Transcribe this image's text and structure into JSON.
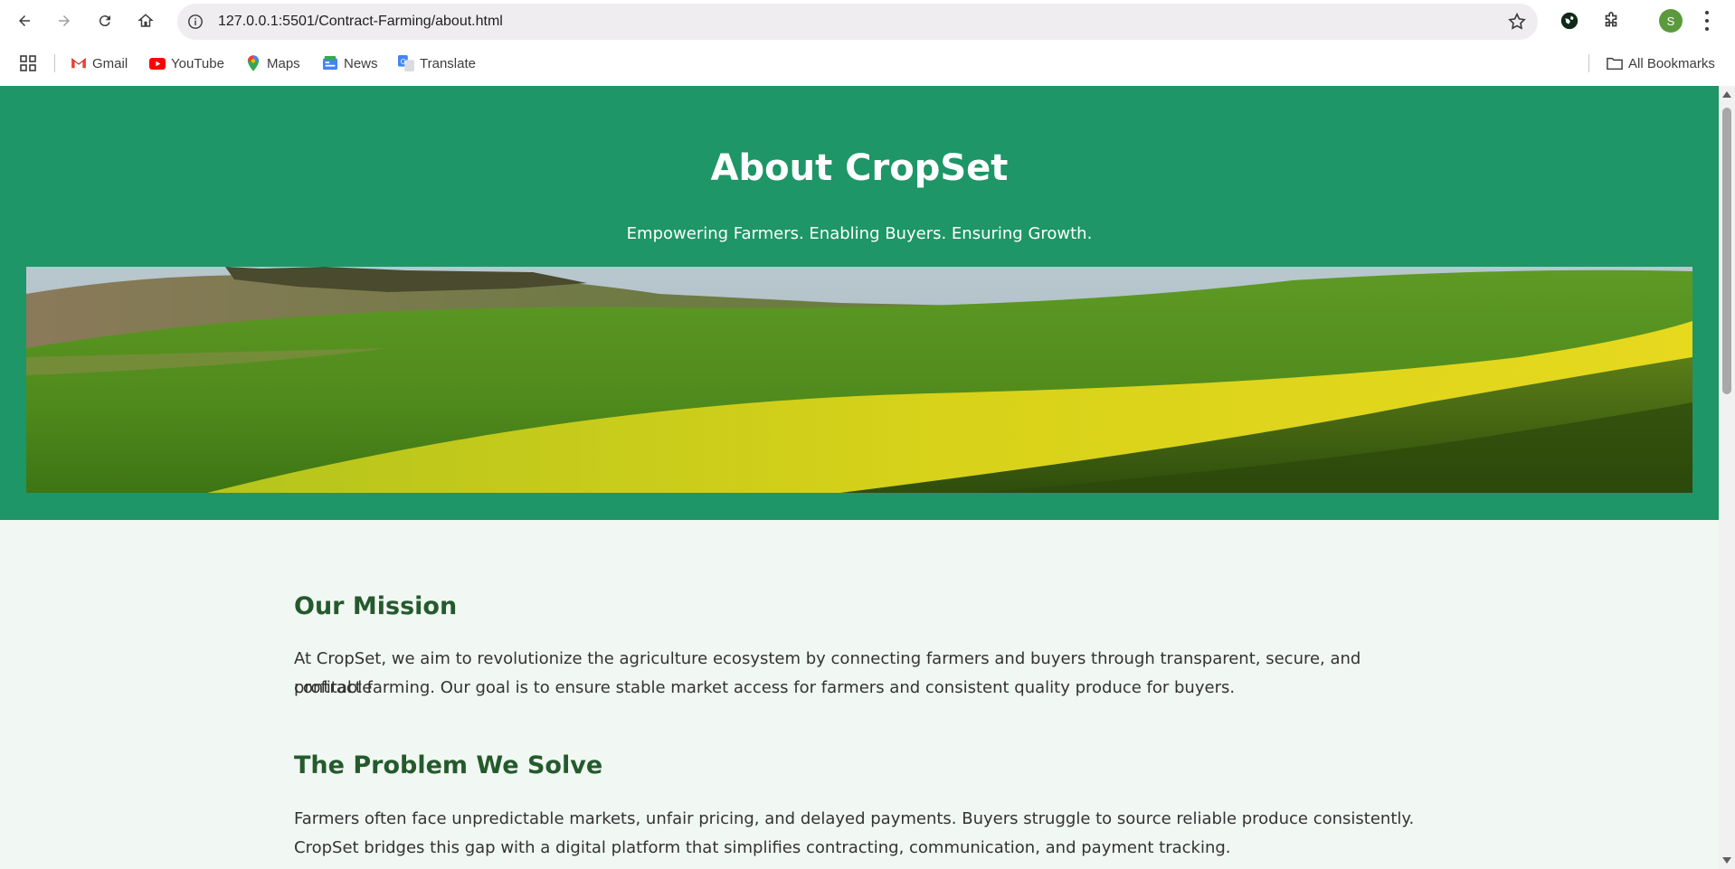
{
  "browser": {
    "url": "127.0.0.1:5501/Contract-Farming/about.html",
    "profile_initial": "S",
    "bookmarks": [
      {
        "label": "Gmail",
        "icon": "gmail-icon"
      },
      {
        "label": "YouTube",
        "icon": "youtube-icon"
      },
      {
        "label": "Maps",
        "icon": "maps-icon"
      },
      {
        "label": "News",
        "icon": "news-icon"
      },
      {
        "label": "Translate",
        "icon": "translate-icon"
      }
    ],
    "all_bookmarks_label": "All Bookmarks"
  },
  "page": {
    "title": "About CropSet",
    "tagline": "Empowering Farmers. Enabling Buyers. Ensuring Growth.",
    "banner_icon": "farmland-banner-image",
    "colors": {
      "hero": "#1e9667",
      "heading": "#245a2c",
      "background": "#f1f7f3"
    },
    "sections": [
      {
        "heading": "Our Mission",
        "lines": [
          "At CropSet, we aim to revolutionize the agriculture ecosystem by connecting farmers and buyers through transparent, secure, and profitable",
          "contract farming. Our goal is to ensure stable market access for farmers and consistent quality produce for buyers."
        ]
      },
      {
        "heading": "The Problem We Solve",
        "lines": [
          "Farmers often face unpredictable markets, unfair pricing, and delayed payments. Buyers struggle to source reliable produce consistently.",
          "CropSet bridges this gap with a digital platform that simplifies contracting, communication, and payment tracking."
        ]
      }
    ]
  }
}
